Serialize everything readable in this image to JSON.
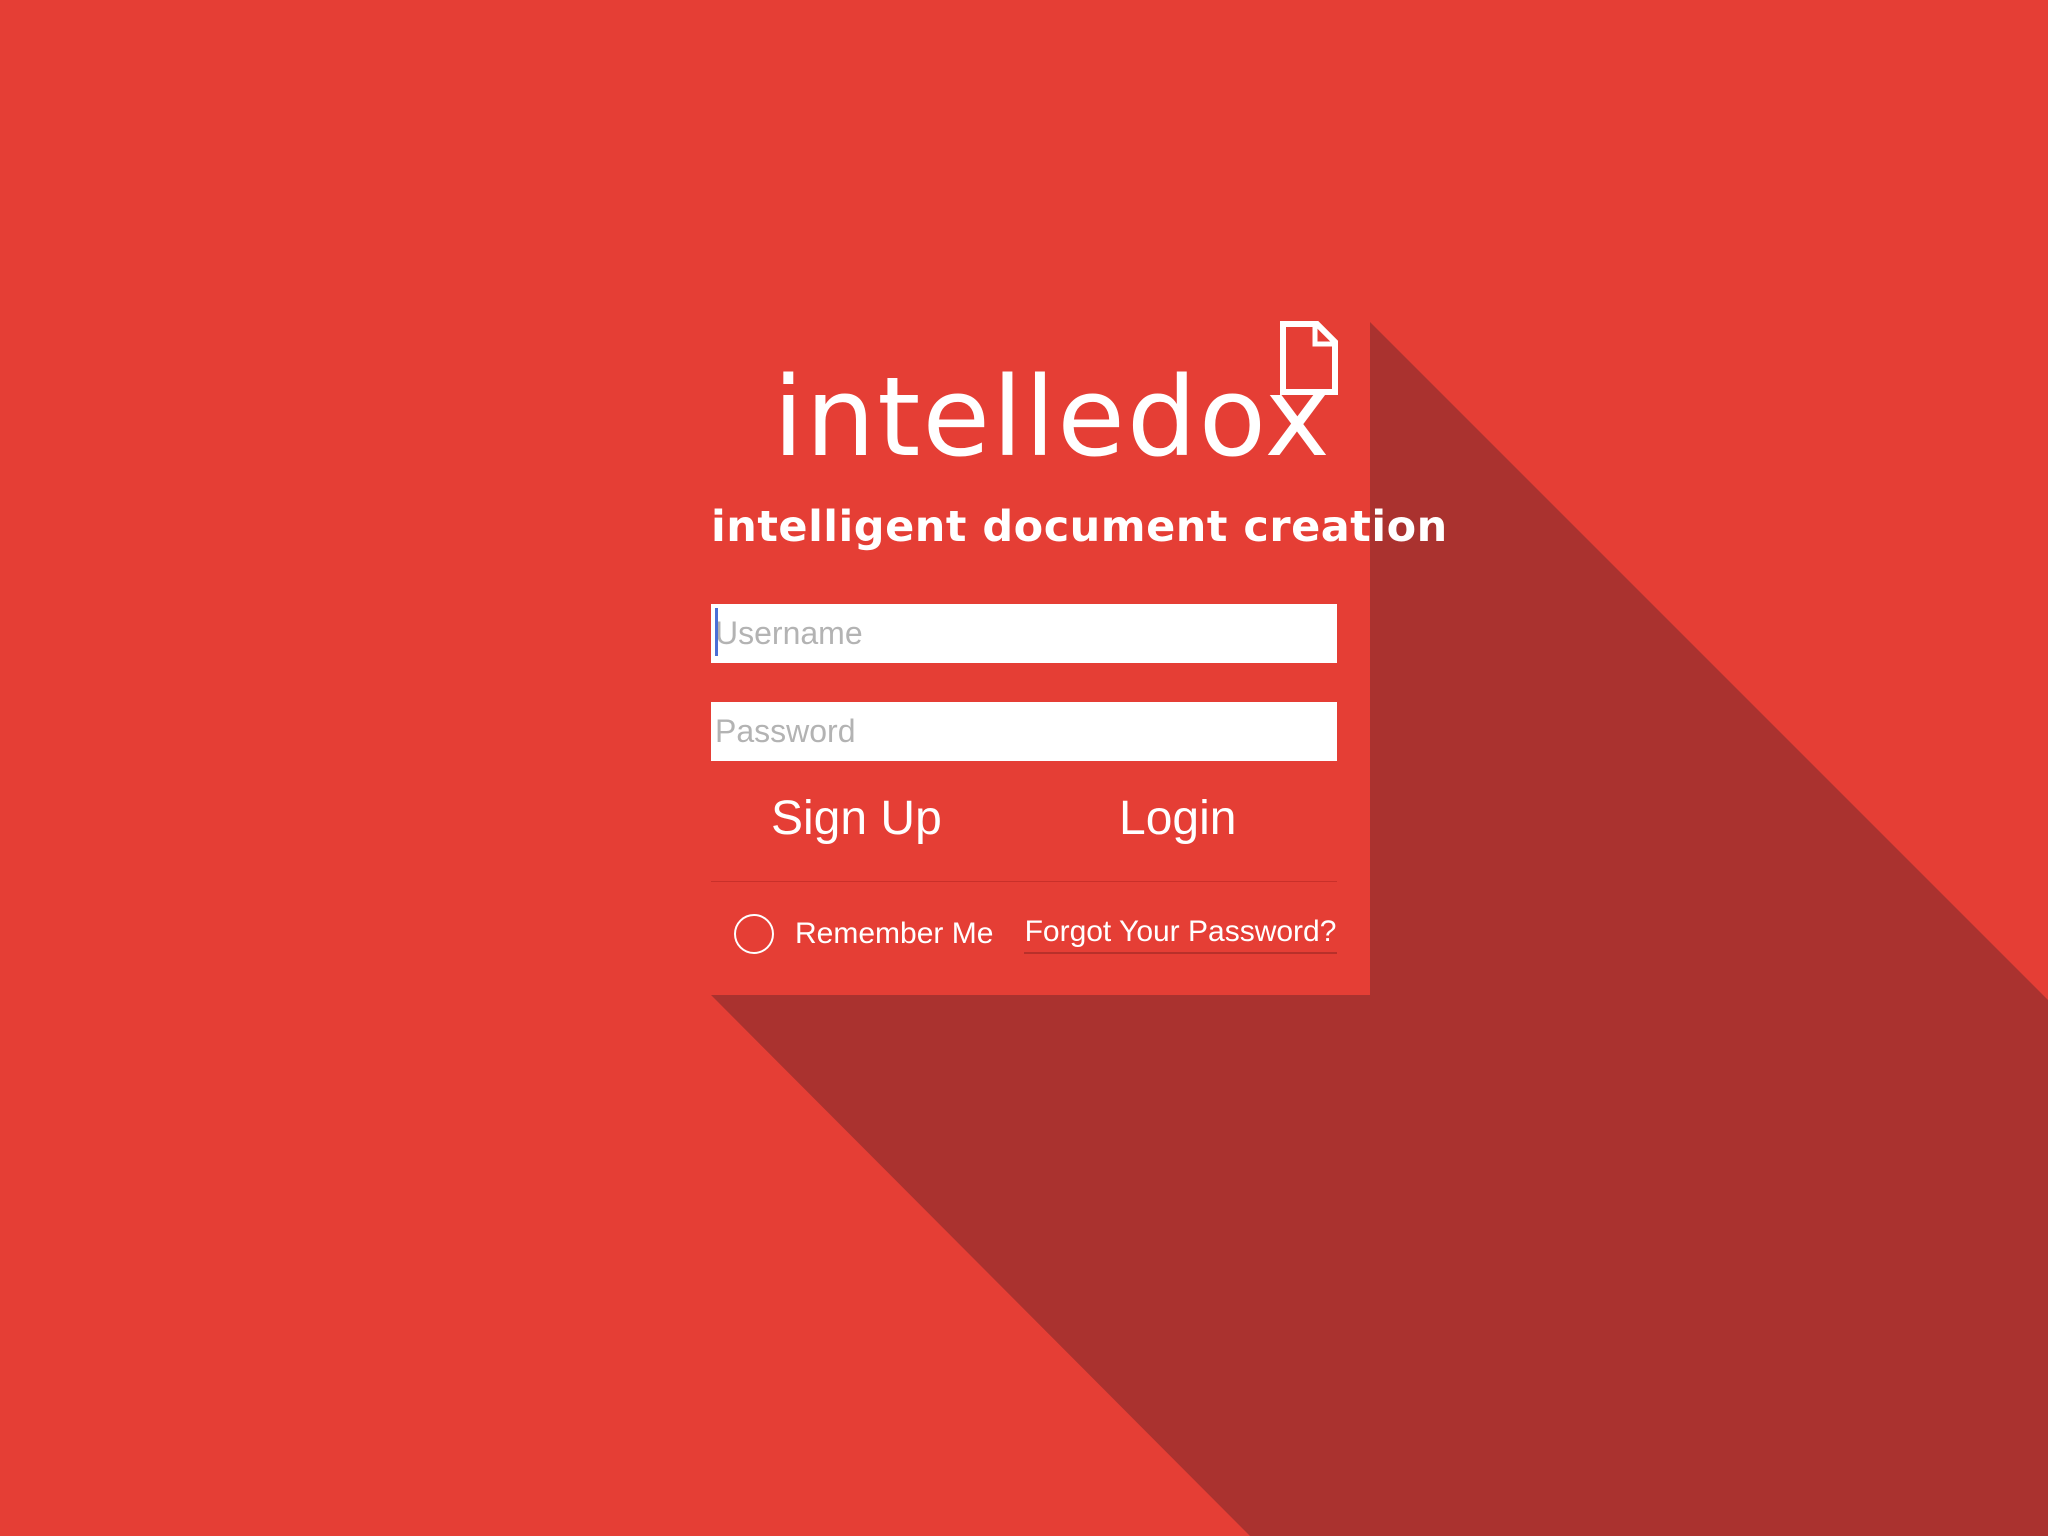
{
  "brand": {
    "name": "intelledox",
    "tagline": "intelligent document creation",
    "logo_icon": "document-icon"
  },
  "form": {
    "username_placeholder": "Username",
    "username_value": "",
    "password_placeholder": "Password",
    "password_value": "",
    "sign_up_label": "Sign Up",
    "login_label": "Login",
    "remember_me_label": "Remember Me",
    "remember_me_checked": false,
    "forgot_password_label": "Forgot Your Password?"
  },
  "colors": {
    "background": "#e53e35",
    "long_shadow": "#aa322f",
    "text": "#ffffff",
    "caret": "#4a6fd6"
  }
}
